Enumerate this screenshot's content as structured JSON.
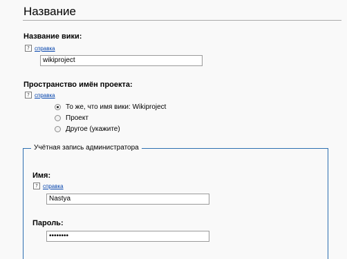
{
  "page": {
    "title": "Название"
  },
  "wiki_name": {
    "label": "Название вики:",
    "help_link": "справка",
    "value": "wikiproject"
  },
  "namespace": {
    "label": "Пространство имён проекта:",
    "help_link": "справка",
    "options": [
      {
        "label": "То же, что имя вики: Wikiproject",
        "selected": true
      },
      {
        "label": "Проект",
        "selected": false
      },
      {
        "label": "Другое (укажите)",
        "selected": false
      }
    ]
  },
  "admin_account": {
    "legend": "Учётная запись администратора",
    "name_label": "Имя:",
    "help_link": "справка",
    "name_value": "Nastya",
    "password_label": "Пароль:",
    "password_value": "••••••••"
  },
  "icons": {
    "help": "help-question-icon"
  },
  "colors": {
    "link": "#0645ad",
    "fieldset_border": "#2a6db0",
    "background": "#f9f9f9"
  }
}
